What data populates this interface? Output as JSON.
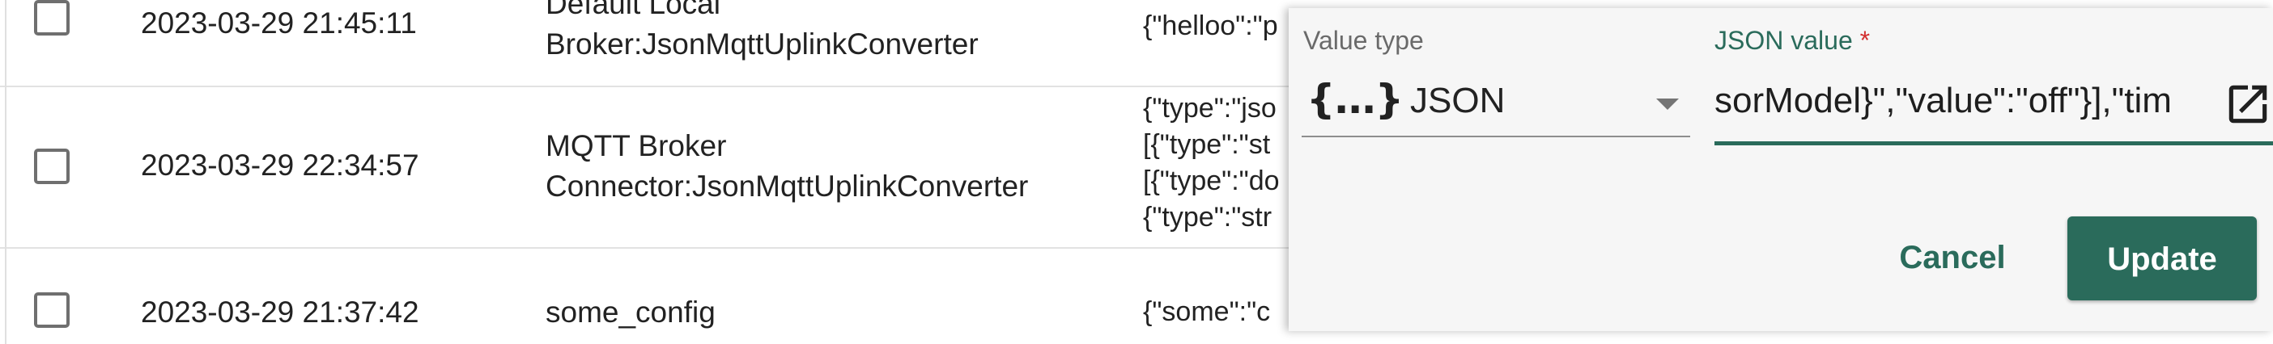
{
  "table": {
    "rows": [
      {
        "timestamp": "2023-03-29 21:45:11",
        "source_line1": "Default Local",
        "source_line2": "Broker:JsonMqttUplinkConverter",
        "json_lines": [
          "{\"helloo\":\"p"
        ]
      },
      {
        "timestamp": "2023-03-29 22:34:57",
        "source_line1": "MQTT Broker",
        "source_line2": "Connector:JsonMqttUplinkConverter",
        "json_lines": [
          "{\"type\":\"jso",
          "[{\"type\":\"st",
          "[{\"type\":\"do",
          "{\"type\":\"str"
        ]
      },
      {
        "timestamp": "2023-03-29 21:37:42",
        "source_line1": "some_config",
        "json_lines": [
          "{\"some\":\"c"
        ]
      }
    ]
  },
  "editor": {
    "value_type_label": "Value type",
    "value_type_icon": "{...}",
    "value_type_value": "JSON",
    "json_value_label": "JSON value",
    "json_value_required_mark": "*",
    "json_value_text": "sorModel}\",\"value\":\"off\"}],\"tim",
    "cancel_label": "Cancel",
    "update_label": "Update",
    "accent_color": "#2a6b5b"
  }
}
